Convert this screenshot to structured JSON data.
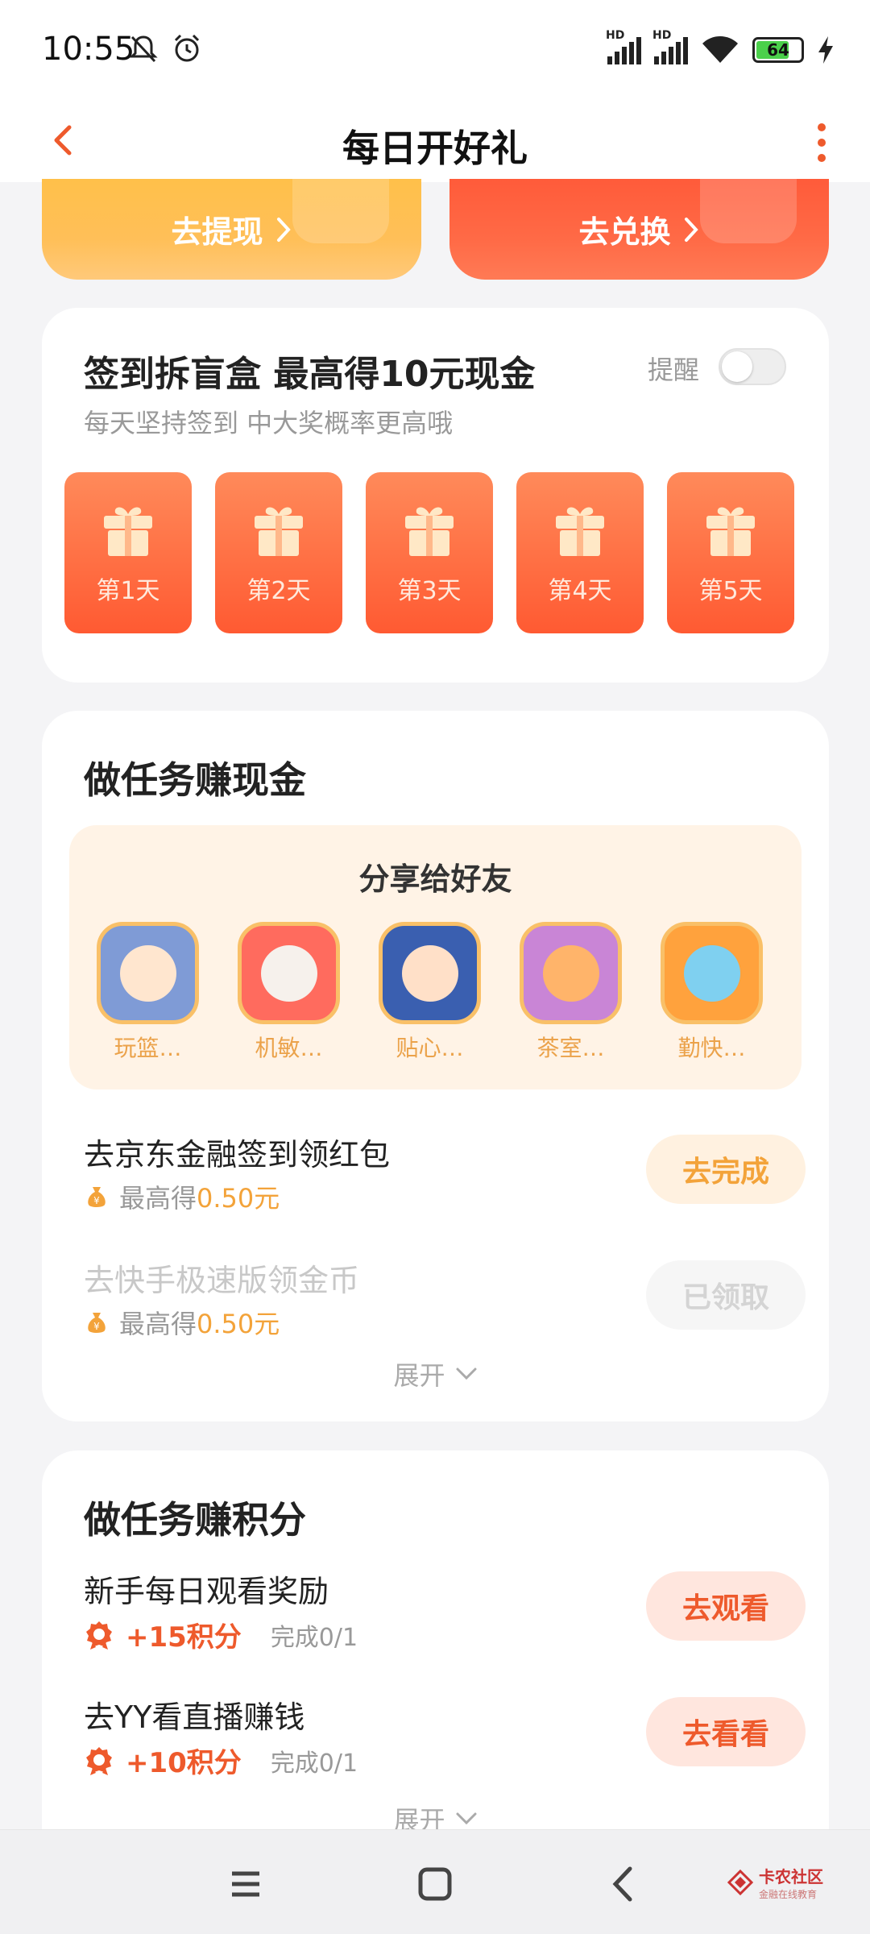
{
  "status_bar": {
    "time": "10:55",
    "battery": "64",
    "network_label": "HD"
  },
  "header": {
    "title": "每日开好礼"
  },
  "top_buttons": {
    "withdraw": "去提现",
    "exchange": "去兑换"
  },
  "signin": {
    "title": "签到拆盲盒 最高得10元现金",
    "subtitle": "每天坚持签到 中大奖概率更高哦",
    "remind_label": "提醒",
    "remind_enabled": false,
    "days": [
      {
        "label": "第1天"
      },
      {
        "label": "第2天"
      },
      {
        "label": "第3天"
      },
      {
        "label": "第4天"
      },
      {
        "label": "第5天"
      }
    ]
  },
  "cash_tasks": {
    "title": "做任务赚现金",
    "share": {
      "title": "分享给好友",
      "friends": [
        {
          "name": "玩篮…",
          "color": "#7f9bd6",
          "icon": "avatar-girl-icon"
        },
        {
          "name": "机敏…",
          "color": "#ff6b5e",
          "icon": "avatar-white-creature-icon"
        },
        {
          "name": "贴心…",
          "color": "#3a5fb0",
          "icon": "avatar-boy-glasses-icon"
        },
        {
          "name": "茶室…",
          "color": "#c985d6",
          "icon": "avatar-girl-cap-icon"
        },
        {
          "name": "勤快…",
          "color": "#ffa23d",
          "icon": "avatar-boy-colorful-icon"
        }
      ]
    },
    "tasks": [
      {
        "title": "去京东金融签到领红包",
        "prefix": "最高得",
        "value": "0.50元",
        "button": "去完成",
        "done": false
      },
      {
        "title": "去快手极速版领金币",
        "prefix": "最高得",
        "value": "0.50元",
        "button": "已领取",
        "done": true
      }
    ],
    "expand_label": "展开"
  },
  "point_tasks": {
    "title": "做任务赚积分",
    "tasks": [
      {
        "title": "新手每日观看奖励",
        "points": "+15积分",
        "progress": "完成0/1",
        "button": "去观看"
      },
      {
        "title": "去YY看直播赚钱",
        "points": "+10积分",
        "progress": "完成0/1",
        "button": "去看看"
      }
    ],
    "expand_label": "展开"
  },
  "watermark": {
    "main": "卡农社区",
    "sub": "金融在线教育"
  },
  "colors": {
    "accent_orange": "#ff5a32",
    "gold": "#f3a33a",
    "red_text": "#ee5a2c"
  }
}
